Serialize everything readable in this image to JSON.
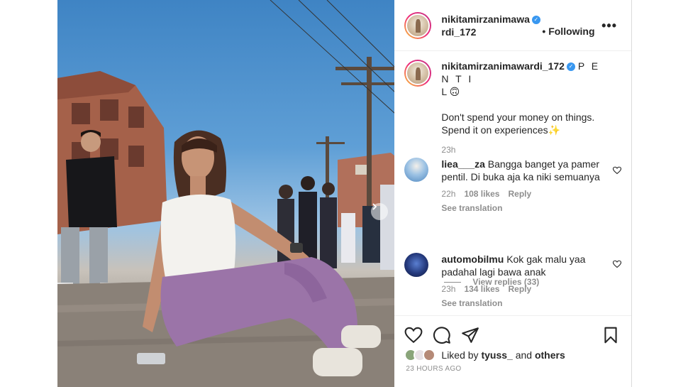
{
  "post": {
    "author": "nikitamirzanimawardi_172",
    "header_username_line1": "nikitamirzanimawa",
    "header_username_line2": "rdi_172",
    "following_label": "• Following",
    "more_glyph": "•••",
    "caption": {
      "username": "nikitamirzanimawardi_172",
      "line1": "P E N T I",
      "line2": "L 🙃",
      "quote": "Don't spend your money on things. Spend it on experiences✨",
      "time": "23h"
    }
  },
  "comments": [
    {
      "username": "liea___za",
      "text": "Bangga banget ya pamer pentil. Di buka aja ka niki semuanya",
      "time": "22h",
      "likes": "108 likes",
      "reply_label": "Reply",
      "translate_label": "See translation",
      "avatar_color": "#6fa7d8"
    },
    {
      "username": "automobilmu",
      "text": "Kok gak malu yaa padahal lagi bawa anak",
      "time": "23h",
      "likes": "134 likes",
      "reply_label": "Reply",
      "translate_label": "See translation",
      "avatar_color": "#1f2f6b"
    }
  ],
  "view_replies_label": "View replies (33)",
  "footer": {
    "liked_by_prefix": "Liked by",
    "liked_by_user": "tyuss_",
    "liked_by_and": "and",
    "liked_by_others": "others",
    "timestamp": "23 HOURS AGO"
  },
  "icons": {
    "verified": "verified-badge-icon",
    "like": "heart-icon",
    "comment": "comment-bubble-icon",
    "share": "paper-plane-icon",
    "save": "bookmark-icon",
    "carousel": "chevron-right-icon"
  },
  "colors": {
    "verified": "#3897f0",
    "muted_text": "#8e8e8e",
    "primary_text": "#262626",
    "avatar_ring": "#ee2a7b"
  }
}
